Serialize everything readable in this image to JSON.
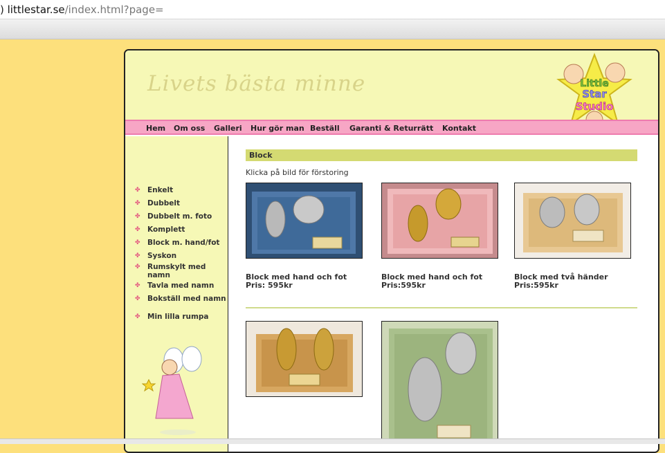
{
  "browser": {
    "host": "littlestar.se",
    "path": "/index.html?page="
  },
  "header": {
    "slogan": "Livets bästa minne",
    "logo_text": "Little Star Studio"
  },
  "nav": [
    {
      "label": "Hem"
    },
    {
      "label": "Om oss"
    },
    {
      "label": "Galleri"
    },
    {
      "label": "Hur gör man"
    },
    {
      "label": "Beställ"
    },
    {
      "label": "Garanti & Returrätt"
    },
    {
      "label": "Kontakt"
    }
  ],
  "sidebar": {
    "items": [
      {
        "label": "Enkelt"
      },
      {
        "label": "Dubbelt"
      },
      {
        "label": "Dubbelt m. foto"
      },
      {
        "label": "Komplett"
      },
      {
        "label": "Block m. hand/fot"
      },
      {
        "label": "Syskon"
      },
      {
        "label": "Rumskylt med namn"
      },
      {
        "label": "Tavla med namn"
      },
      {
        "label": "Bokställ med namn"
      },
      {
        "label": "Min lilla rumpa"
      }
    ]
  },
  "main": {
    "section_title": "Block",
    "hint": "Klicka på bild för förstoring",
    "products": [
      {
        "name": "Block med hand och fot",
        "price": "Pris: 595kr",
        "plaque": "#3f6a99",
        "metal": "silver"
      },
      {
        "name": "Block med hand och fot",
        "price": "Pris:595kr",
        "plaque": "#e7a4a6",
        "metal": "gold"
      },
      {
        "name": "Block med två händer",
        "price": "Pris:595kr",
        "plaque": "#e8c893",
        "metal": "silver"
      },
      {
        "name": "",
        "price": "",
        "plaque": "#d7a760",
        "metal": "gold"
      },
      {
        "name": "",
        "price": "",
        "plaque": "#a9c08c",
        "metal": "silver"
      }
    ]
  },
  "colors": {
    "background": "#fde07c",
    "header": "#f6f8b6",
    "nav": "#f7a6c5",
    "section_bar": "#d4da72"
  }
}
